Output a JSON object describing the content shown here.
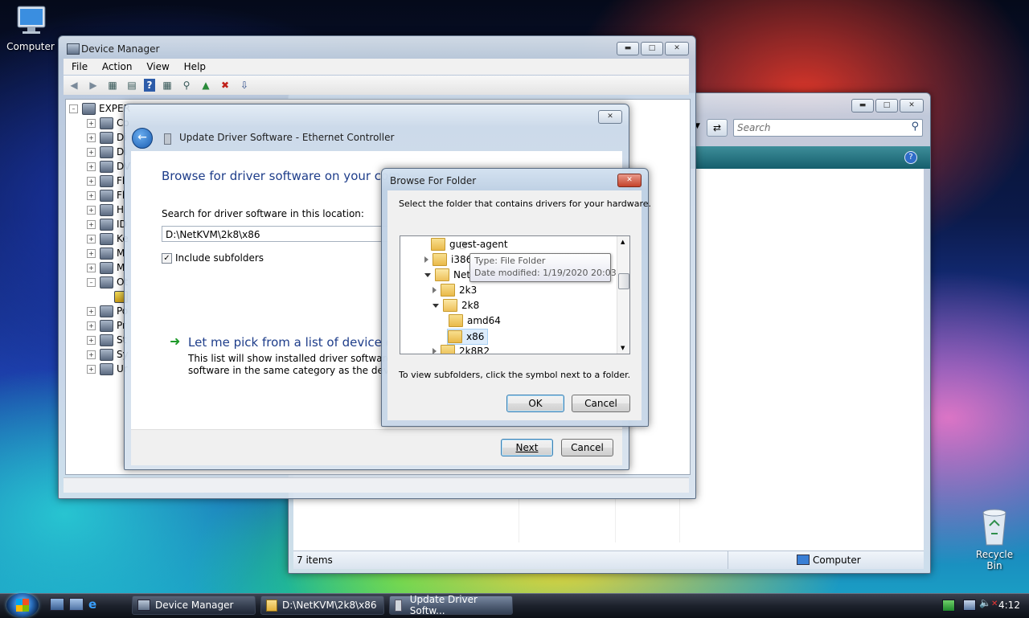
{
  "desktop": {
    "computer_label": "Computer",
    "recycle_label": "Recycle Bin"
  },
  "device_manager": {
    "title": "Device Manager",
    "menu": [
      "File",
      "Action",
      "View",
      "Help"
    ],
    "tree_root": "EXPER",
    "tree_items": [
      "Co",
      "Di",
      "Di",
      "DV",
      "Fl",
      "Fl",
      "H",
      "ID",
      "Ke",
      "M",
      "M",
      "Ot",
      "",
      "Po",
      "Pr",
      "St",
      "Sy",
      "Ur"
    ]
  },
  "explorer": {
    "search_placeholder": "Search",
    "status_items": "7 items",
    "status_location": "Computer"
  },
  "update_driver": {
    "title": "Update Driver Software - Ethernet Controller",
    "heading": "Browse for driver software on your com",
    "search_label": "Search for driver software in this location:",
    "path_value": "D:\\NetKVM\\2k8\\x86",
    "include_subfolders": "Include subfolders",
    "pick_link": "Let me pick from a list of device dri",
    "pick_desc_line1": "This list will show installed driver software cor",
    "pick_desc_line2": "software in the same category as the device.",
    "next": "Next",
    "cancel": "Cancel"
  },
  "browse_folder": {
    "title": "Browse For Folder",
    "instruction": "Select the folder that contains drivers for your hardware.",
    "tree": [
      {
        "label": "guest-agent",
        "indent": 0,
        "expander": "none"
      },
      {
        "label": "i386",
        "indent": 0,
        "expander": "collapsed"
      },
      {
        "label": "NetK",
        "indent": 0,
        "expander": "expanded"
      },
      {
        "label": "2k3",
        "indent": 1,
        "expander": "collapsed"
      },
      {
        "label": "2k8",
        "indent": 1,
        "expander": "expanded"
      },
      {
        "label": "amd64",
        "indent": 2,
        "expander": "none"
      },
      {
        "label": "x86",
        "indent": 2,
        "expander": "none",
        "selected": true
      },
      {
        "label": "2k8R2",
        "indent": 1,
        "expander": "collapsed"
      }
    ],
    "tooltip_line1": "Type: File Folder",
    "tooltip_line2": "Date modified: 1/19/2020 20:03",
    "hint": "To view subfolders, click the symbol next to a folder.",
    "ok": "OK",
    "cancel": "Cancel"
  },
  "taskbar": {
    "buttons": [
      "Device Manager",
      "D:\\NetKVM\\2k8\\x86",
      "Update Driver Softw..."
    ],
    "clock": "4:12"
  }
}
